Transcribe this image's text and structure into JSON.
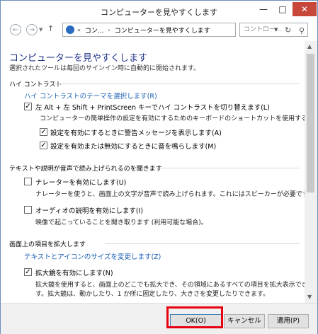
{
  "window": {
    "title": "コンピューターを見やすくします",
    "controls": {
      "minimize": "—",
      "maximize": "□",
      "close": "✕"
    }
  },
  "nav": {
    "back": "←",
    "forward": "→",
    "up": "↑",
    "breadcrumb": [
      "コン...",
      "コンピューターを見やすくします"
    ],
    "breadcrumb_prefix": "«",
    "search_placeholder": "コントロー..."
  },
  "main": {
    "title": "コンピューターを見やすくします",
    "subtitle": "選択されたツールは毎回のサインイン時に自動的に開始されます。",
    "high_contrast": {
      "heading": "ハイ コントラスト",
      "theme_link": "ハイ コントラストのテーマを選択します(R)",
      "toggle_label": "左 Alt + 左 Shift + PrintScreen キーでハイ コントラストを切り替えます(L)",
      "toggle_checked": true,
      "shortcut_note": "コンピューターの簡単操作の設定を有効にするためのキーボードのショートカットを使用する場合:",
      "warning_label": "設定を有効にするときに警告メッセージを表示します(A)",
      "warning_checked": true,
      "sound_label": "設定を有効または無効にするときに音を鳴らします(M)",
      "sound_checked": true
    },
    "text_speech": {
      "heading": "テキストや説明が音声で読み上げられるのを聞きます",
      "narrator_label": "ナレーターを有効にします(U)",
      "narrator_checked": false,
      "narrator_note": "ナレーターを使うと、画面上の文字が音声で読み上げられます。これにはスピーカーが必要です。",
      "audio_desc_label": "オーディオの説明を有効にします(I)",
      "audio_desc_checked": false,
      "audio_desc_note": "映像で起こっていることを聞き取ります (利用可能な場合)。"
    },
    "magnify": {
      "heading": "画面上の項目を拡大します",
      "size_link": "テキストとアイコンのサイズを変更します(Z)",
      "magnifier_label": "拡大鏡を有効にします(N)",
      "magnifier_checked": true,
      "magnifier_note_1": "拡大鏡を使用すると、画面上のどこでも拡大でき、その領域にあるすべての項目を拡大表示できま",
      "magnifier_note_2": "す。拡大鏡は、動かしたり、1 か所に固定したり、大きさを変更したりできます。"
    }
  },
  "footer": {
    "ok": "OK(O)",
    "cancel": "キャンセル",
    "apply": "適用(P)"
  },
  "colors": {
    "title_blue": "#1e3287",
    "link_blue": "#1a5fb4",
    "close_red": "#c7473a",
    "highlight_red": "#e60012"
  }
}
